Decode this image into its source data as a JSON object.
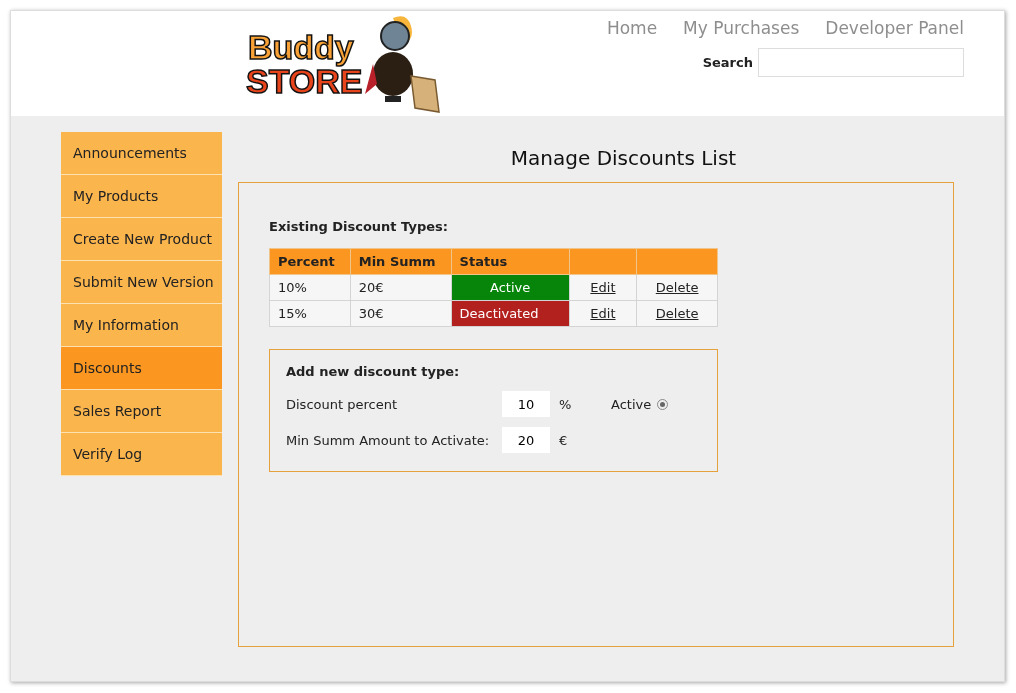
{
  "logo": {
    "line_1": "Buddy",
    "line_2": "STORE"
  },
  "nav": [
    {
      "label": "Home"
    },
    {
      "label": "My Purchases"
    },
    {
      "label": "Developer Panel"
    }
  ],
  "search": {
    "label": "Search"
  },
  "sidebar": {
    "items": [
      {
        "label": "Announcements",
        "selected": false
      },
      {
        "label": "My Products",
        "selected": false
      },
      {
        "label": "Create New Product",
        "selected": false
      },
      {
        "label": "Submit New Version",
        "selected": false
      },
      {
        "label": "My Information",
        "selected": false
      },
      {
        "label": "Discounts",
        "selected": true
      },
      {
        "label": "Sales Report",
        "selected": false
      },
      {
        "label": "Verify Log",
        "selected": false
      }
    ]
  },
  "page_title": "Manage Discounts List",
  "existing": {
    "heading": "Existing Discount Types:",
    "columns": [
      "Percent",
      "Min Summ",
      "Status"
    ],
    "rows": [
      {
        "percent": "10%",
        "min_summ": "20€",
        "status": "Active",
        "active": true,
        "edit": "Edit",
        "delete": "Delete"
      },
      {
        "percent": "15%",
        "min_summ": "30€",
        "status": "Deactivated",
        "active": false,
        "edit": "Edit",
        "delete": "Delete"
      }
    ]
  },
  "add_form": {
    "heading": "Add new discount type:",
    "percent_label": "Discount percent",
    "percent_value": "10",
    "percent_unit": "%",
    "active_label": "Active",
    "active_checked": true,
    "min_label": "Min Summ Amount to Activate:",
    "min_value": "20",
    "min_unit": "€"
  }
}
